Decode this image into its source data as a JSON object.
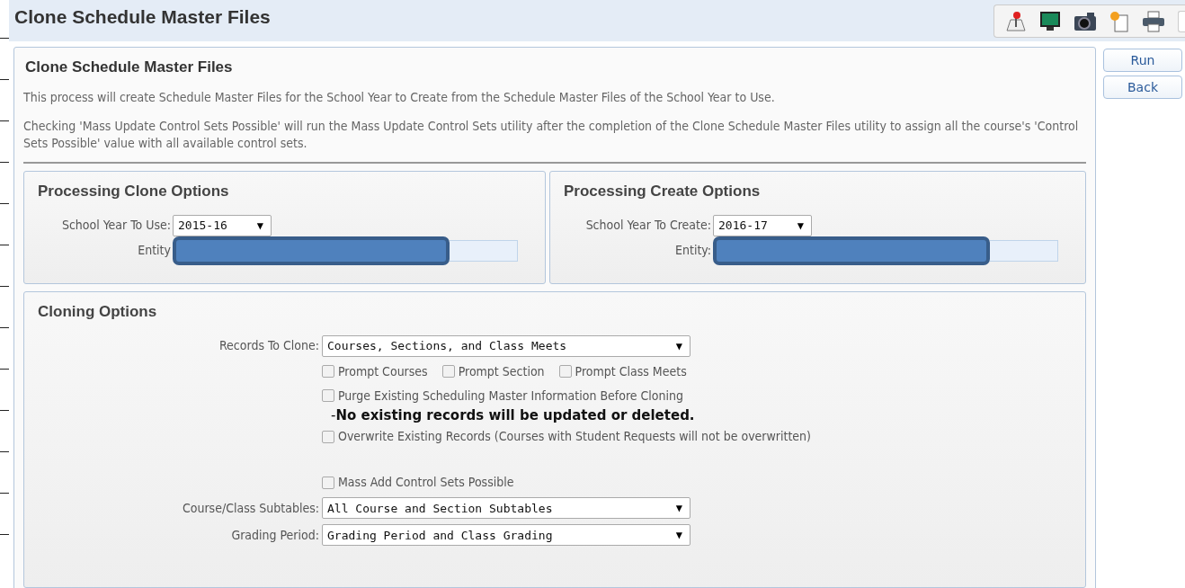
{
  "page_title": "Clone Schedule Master Files",
  "buttons": [
    {
      "label": "Run"
    },
    {
      "label": "Back"
    }
  ],
  "panel": {
    "title": "Clone Schedule Master Files",
    "paragraphs": [
      "This process will create Schedule Master Files for the School Year to Create from the Schedule Master Files of the School Year to Use.",
      "Checking 'Mass Update Control Sets Possible' will run the Mass Update Control Sets utility after the completion of the Clone Schedule Master Files utility to assign all the course's 'Control Sets Possible' value with all available control sets."
    ]
  },
  "option_groups": [
    {
      "title": "Processing Clone Options",
      "fields": [
        {
          "kind": "select",
          "label": "School Year To Use:",
          "value": "2015-16",
          "arrow": "▼"
        },
        {
          "kind": "redacted",
          "label": "Entity"
        }
      ]
    },
    {
      "title": "Processing Create Options",
      "fields": [
        {
          "kind": "select",
          "label": "School Year To Create:",
          "value": "2016-17",
          "arrow": "▼"
        },
        {
          "kind": "redacted",
          "label": "Entity:"
        }
      ]
    }
  ],
  "cloning_options": {
    "title": "Cloning Options",
    "rows": [
      {
        "kind": "select",
        "label": "Records To Clone:",
        "value": "Courses, Sections, and Class Meets",
        "arrow": "▼"
      },
      {
        "kind": "checks",
        "items": [
          {
            "label": "Prompt Courses",
            "checked": false
          },
          {
            "label": "Prompt Section",
            "checked": false
          },
          {
            "label": "Prompt Class Meets",
            "checked": false
          }
        ]
      },
      {
        "kind": "checks",
        "items": [
          {
            "label": "Purge Existing Scheduling Master Information Before Cloning",
            "checked": false
          }
        ]
      },
      {
        "kind": "note",
        "text": "-**No existing records will be updated or deleted.**"
      },
      {
        "kind": "checks",
        "items": [
          {
            "label": "Overwrite Existing Records (Courses with Student Requests will not be overwritten)",
            "checked": false
          }
        ]
      },
      {
        "kind": "spacer"
      },
      {
        "kind": "checks",
        "items": [
          {
            "label": "Mass Add Control Sets Possible",
            "checked": false
          }
        ]
      },
      {
        "kind": "select",
        "label": "Course/Class Subtables:",
        "value": "All Course and Section Subtables",
        "arrow": "▼"
      },
      {
        "kind": "select",
        "label": "Grading Period:",
        "value": "Grading Period and Class Grading",
        "arrow": "▼"
      }
    ]
  }
}
